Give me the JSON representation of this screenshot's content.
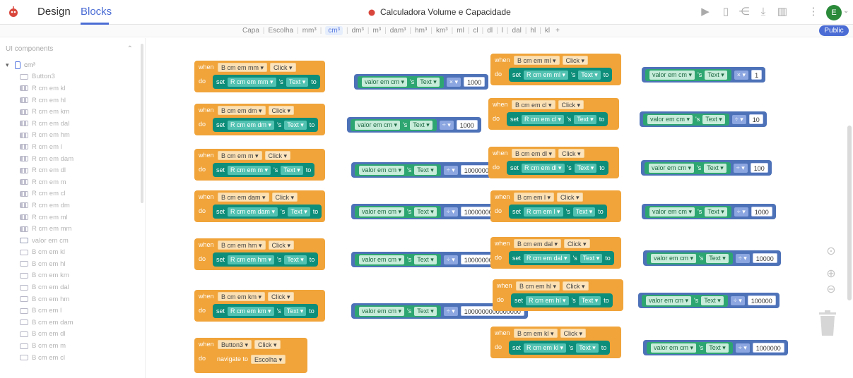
{
  "nav": {
    "tab_design": "Design",
    "tab_blocks": "Blocks"
  },
  "project": {
    "title": "Calculadora Volume e Capacidade"
  },
  "user": {
    "initial": "E"
  },
  "screens": [
    "Capa",
    "Escolha",
    "mm³",
    "cm³",
    "dm³",
    "m³",
    "dam³",
    "hm³",
    "km³",
    "ml",
    "cl",
    "dl",
    "l",
    "dal",
    "hl",
    "kl",
    "+"
  ],
  "active_screen": "cm³",
  "public_label": "Public",
  "sidebar": {
    "title": "UI components",
    "root": "cm³",
    "items": [
      {
        "label": "Button3",
        "kind": "button"
      },
      {
        "label": "R cm em kl",
        "kind": "label"
      },
      {
        "label": "R cm em hl",
        "kind": "label"
      },
      {
        "label": "R cm em km",
        "kind": "label"
      },
      {
        "label": "R cm em dal",
        "kind": "label"
      },
      {
        "label": "R cm em hm",
        "kind": "label"
      },
      {
        "label": "R cm em l",
        "kind": "label"
      },
      {
        "label": "R cm em dam",
        "kind": "label"
      },
      {
        "label": "R cm em dl",
        "kind": "label"
      },
      {
        "label": "R cm em m",
        "kind": "label"
      },
      {
        "label": "R cm em cl",
        "kind": "label"
      },
      {
        "label": "R cm em dm",
        "kind": "label"
      },
      {
        "label": "R cm em ml",
        "kind": "label"
      },
      {
        "label": "R cm em mm",
        "kind": "label"
      },
      {
        "label": "valor em cm",
        "kind": "textbox"
      },
      {
        "label": "B cm em kl",
        "kind": "button"
      },
      {
        "label": "B cm em hl",
        "kind": "button"
      },
      {
        "label": "B cm em km",
        "kind": "button"
      },
      {
        "label": "B cm em dal",
        "kind": "button"
      },
      {
        "label": "B cm em hm",
        "kind": "button"
      },
      {
        "label": "B cm em l",
        "kind": "button"
      },
      {
        "label": "B cm em dam",
        "kind": "button"
      },
      {
        "label": "B cm em dl",
        "kind": "button"
      },
      {
        "label": "B cm em m",
        "kind": "button"
      },
      {
        "label": "B cm em cl",
        "kind": "button"
      }
    ]
  },
  "blocks_text": {
    "when": "when",
    "do": "do",
    "set": "set",
    "to": "to",
    "s": "'s",
    "click": "Click",
    "text": "Text",
    "input": "valor em cm",
    "navigate": "navigate to"
  },
  "blocks": [
    {
      "btn": "B cm em mm",
      "label": "R cm em mm",
      "op": "×",
      "value": "1000"
    },
    {
      "btn": "B cm em dm",
      "label": "R cm em dm",
      "op": "÷",
      "value": "1000"
    },
    {
      "btn": "B cm em m",
      "label": "R cm em m",
      "op": "÷",
      "value": "1000000"
    },
    {
      "btn": "B cm em dam",
      "label": "R cm em dam",
      "op": "÷",
      "value": "1000000000"
    },
    {
      "btn": "B cm em hm",
      "label": "R cm em hm",
      "op": "÷",
      "value": "1000000000000"
    },
    {
      "btn": "B cm em km",
      "label": "R cm em km",
      "op": "÷",
      "value": "1000000000000000"
    },
    {
      "btn": "B cm em ml",
      "label": "R cm em ml",
      "op": "×",
      "value": "1"
    },
    {
      "btn": "B cm em cl",
      "label": "R cm em cl",
      "op": "÷",
      "value": "10"
    },
    {
      "btn": "B cm em dl",
      "label": "R cm em dl",
      "op": "÷",
      "value": "100"
    },
    {
      "btn": "B cm em l",
      "label": "R cm em l",
      "op": "÷",
      "value": "1000"
    },
    {
      "btn": "B cm em dal",
      "label": "R cm em dal",
      "op": "÷",
      "value": "10000"
    },
    {
      "btn": "B cm em hl",
      "label": "R cm em hl",
      "op": "÷",
      "value": "100000"
    },
    {
      "btn": "B cm em kl",
      "label": "R cm em kl",
      "op": "÷",
      "value": "1000000"
    }
  ],
  "nav_block": {
    "btn": "Button3",
    "target": "Escolha"
  }
}
